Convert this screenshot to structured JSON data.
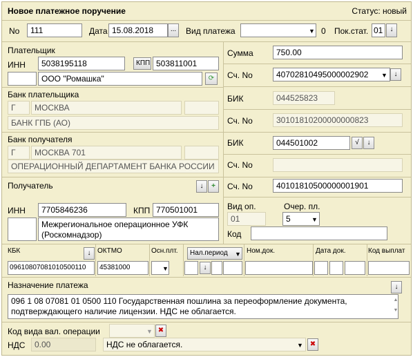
{
  "window": {
    "title": "Новое платежное поручение",
    "status": "Статус: новый"
  },
  "row1": {
    "no_label": "No",
    "no_value": "111",
    "date_label": "Дата",
    "date_value": "15.08.2018",
    "date_btn": "...",
    "pay_type_label": "Вид платежа",
    "pay_type_value": "",
    "pay_type_code": "0",
    "pok_stat_label": "Пок.стат.",
    "pok_stat_value": "01"
  },
  "payer": {
    "label": "Плательщик",
    "inn_label": "ИНН",
    "inn": "5038195118",
    "kpp_btn": "КПП",
    "kpp": "503811001",
    "name": "ООО \"Ромашка\""
  },
  "payer_bank": {
    "label": "Банк плательщика",
    "city_type": "Г",
    "city": "МОСКВА",
    "name": "БАНК ГПБ (АО)"
  },
  "recipient_bank": {
    "label": "Банк получателя",
    "city_type": "Г",
    "city": "МОСКВА 701",
    "name": "ОПЕРАЦИОННЫЙ ДЕПАРТАМЕНТ БАНКА РОССИИ"
  },
  "recipient": {
    "label": "Получатель",
    "inn_label": "ИНН",
    "inn": "7705846236",
    "kpp_label": "КПП",
    "kpp": "770501001",
    "name": "Межрегиональное операционное УФК (Роскомнадзор)"
  },
  "right": {
    "sum_label": "Сумма",
    "sum": "750.00",
    "acc_label": "Сч. No",
    "acc": "40702810495000002902",
    "bik_label": "БИК",
    "bik": "044525823",
    "corr_label": "Сч. No",
    "corr": "30101810200000000823",
    "rbik_label": "БИК",
    "rbik": "044501002",
    "rcorr_label": "Сч. No",
    "rcorr": "",
    "racc_label": "Сч. No",
    "racc": "40101810500000001901",
    "vid_op_label": "Вид оп.",
    "vid_op": "01",
    "ocher_label": "Очер. пл.",
    "ocher": "5",
    "kod_label": "Код",
    "kod": ""
  },
  "budget": {
    "kbk_label": "КБК",
    "kbk": "09610807081010500110",
    "oktmo_label": "ОКТМО",
    "oktmo": "45381000",
    "osn_label": "Осн.плт.",
    "nal_label": "Нал.период",
    "nomdok_label": "Ном.док.",
    "datadok_label": "Дата док.",
    "kodvypl_label": "Код выплат"
  },
  "purpose": {
    "label": "Назначение платежа",
    "text": "096 1 08 07081 01 0500 110 Государственная пошлина за переоформление документа, подтверждающего наличие лицензии. НДС не облагается."
  },
  "footer": {
    "val_label": "Код вида вал. операции",
    "nds_label": "НДС",
    "nds_value": "0.00",
    "nds_text": "НДС не облагается."
  },
  "icons": {
    "arrow": "arrow-down-icon",
    "plus": "plus-icon",
    "check": "check-icon",
    "clear": "clear-icon",
    "refresh": "refresh-icon"
  },
  "colors": {
    "panel": "#f3efcf",
    "border": "#c9c29c"
  }
}
